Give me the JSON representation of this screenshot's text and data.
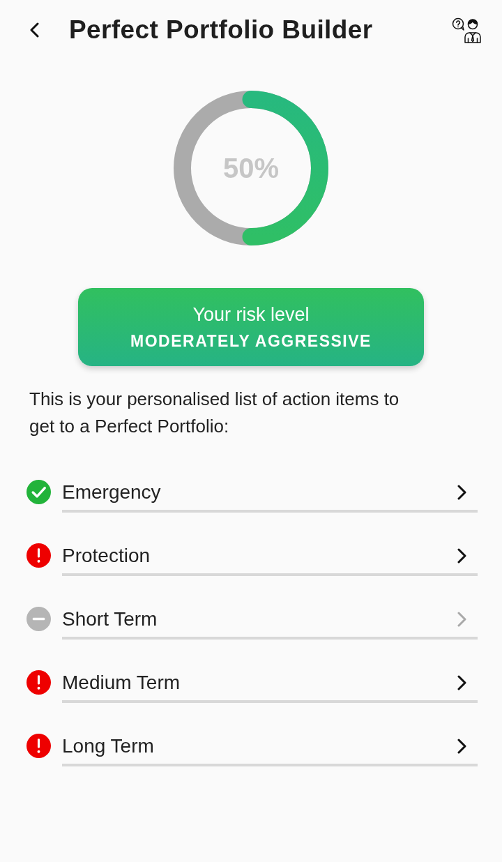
{
  "header": {
    "title": "Perfect Portfolio Builder"
  },
  "progress": {
    "level": 0.5,
    "reading": "50%"
  },
  "risk": {
    "label": "Your risk level",
    "value": "MODERATELY AGGRESSIVE"
  },
  "intro": "This is your personalised list of action items to get to a Perfect Portfolio:",
  "items": [
    {
      "label": "Emergency",
      "kind": "done",
      "disabled": false
    },
    {
      "label": "Protection",
      "kind": "alert",
      "disabled": false
    },
    {
      "label": "Short Term",
      "kind": "none",
      "disabled": true
    },
    {
      "label": "Medium Term",
      "kind": "alert",
      "disabled": false
    },
    {
      "label": "Long Term",
      "kind": "alert",
      "disabled": false
    }
  ]
}
